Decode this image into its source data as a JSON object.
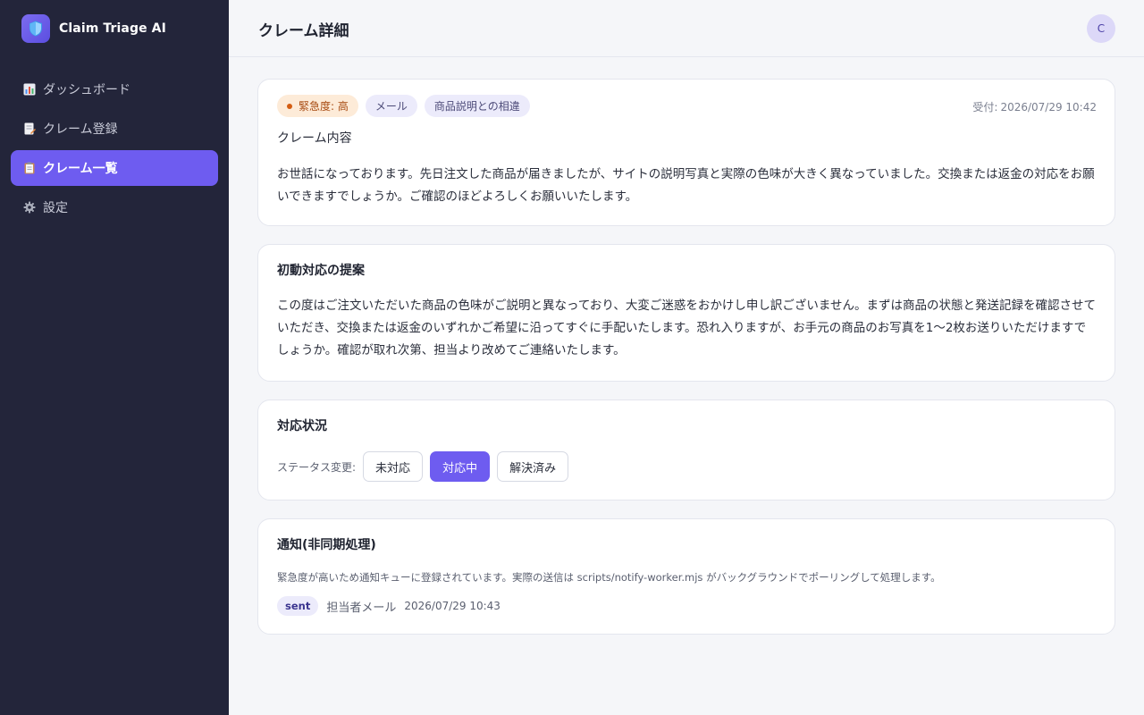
{
  "app": {
    "name": "Claim Triage AI",
    "logo_icon": "shield-icon",
    "accent": "#6e5cf0"
  },
  "sidebar": {
    "items": [
      {
        "label": "ダッシュボード",
        "icon": "bar-chart-icon",
        "active": false
      },
      {
        "label": "クレーム登録",
        "icon": "memo-icon",
        "active": false
      },
      {
        "label": "クレーム一覧",
        "icon": "clipboard-icon",
        "active": true
      },
      {
        "label": "設定",
        "icon": "gear-icon",
        "active": false
      }
    ]
  },
  "header": {
    "title": "クレーム詳細",
    "avatar_initial": "C"
  },
  "claim": {
    "tags": {
      "urgency": "緊急度: 高",
      "channel": "メール",
      "category": "商品説明との相違"
    },
    "received_label": "受付:",
    "received_at": "2026/07/29 10:42",
    "subtitle": "クレーム内容",
    "content": "お世話になっております。先日注文した商品が届きましたが、サイトの説明写真と実際の色味が大きく異なっていました。交換または返金の対応をお願いできますでしょうか。ご確認のほどよろしくお願いいたします。"
  },
  "proposal": {
    "title": "初動対応の提案",
    "text": "この度はご注文いただいた商品の色味がご説明と異なっており、大変ご迷惑をおかけし申し訳ございません。まずは商品の状態と発送記録を確認させていただき、交換または返金のいずれかご希望に沿ってすぐに手配いたします。恐れ入りますが、お手元の商品のお写真を1〜2枚お送りいただけますでしょうか。確認が取れ次第、担当より改めてご連絡いたします。"
  },
  "status": {
    "title": "対応状況",
    "label": "ステータス変更:",
    "options": [
      "未対応",
      "対応中",
      "解決済み"
    ],
    "current": "対応中"
  },
  "notification": {
    "title": "通知(非同期処理)",
    "description": "緊急度が高いため通知キューに登録されています。実際の送信は scripts/notify-worker.mjs がバックグラウンドでポーリングして処理します。",
    "badge": "sent",
    "target": "担当者メール",
    "time": "2026/07/29 10:43"
  }
}
